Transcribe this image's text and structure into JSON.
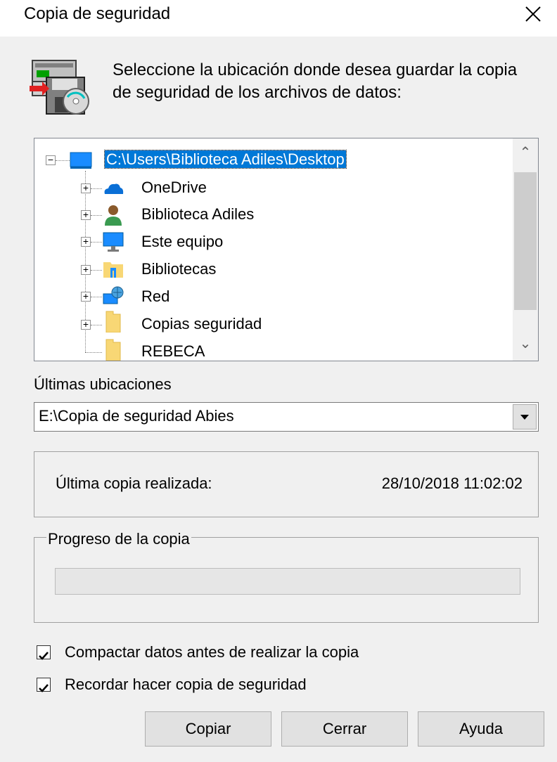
{
  "window": {
    "title": "Copia de seguridad"
  },
  "instruction": "Seleccione la ubicación donde desea guardar la copia de seguridad de los archivos de datos:",
  "tree": {
    "root": "C:\\Users\\Biblioteca Adiles\\Desktop",
    "items": [
      {
        "label": "OneDrive",
        "icon": "cloud-icon"
      },
      {
        "label": "Biblioteca Adiles",
        "icon": "user-icon"
      },
      {
        "label": "Este equipo",
        "icon": "computer-icon"
      },
      {
        "label": "Bibliotecas",
        "icon": "library-folder-icon"
      },
      {
        "label": "Red",
        "icon": "network-icon"
      },
      {
        "label": "Copias seguridad",
        "icon": "folder-icon"
      },
      {
        "label": "REBECA",
        "icon": "folder-icon"
      }
    ]
  },
  "recent": {
    "label": "Últimas ubicaciones",
    "value": "E:\\Copia de seguridad Abies"
  },
  "last_backup": {
    "label": "Última copia realizada:",
    "value": "28/10/2018 11:02:02"
  },
  "progress": {
    "title": "Progreso de la copia",
    "percent": 0
  },
  "options": [
    {
      "label": "Compactar datos antes de realizar la copia",
      "checked": true
    },
    {
      "label": "Recordar hacer copia de seguridad",
      "checked": true
    }
  ],
  "buttons": {
    "copy": "Copiar",
    "close": "Cerrar",
    "help": "Ayuda"
  },
  "colors": {
    "selection": "#0078d7",
    "background": "#f0f0f0"
  }
}
